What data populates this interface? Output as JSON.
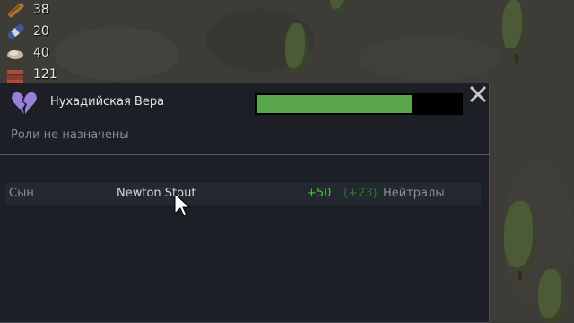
{
  "resources": [
    {
      "icon": "wood-icon",
      "count": "38"
    },
    {
      "icon": "medicine-icon",
      "count": "20"
    },
    {
      "icon": "meat-icon",
      "count": "40"
    },
    {
      "icon": "bricks-icon",
      "count": "121"
    }
  ],
  "ideology": {
    "name": "Нухадийская Вера",
    "icon": "broken-heart-icon",
    "icon_color": "#9a7fd6",
    "progress": 0.76,
    "roles_text": "Роли не назначены"
  },
  "relations": [
    {
      "relation": "Сын",
      "name": "Newton Stout",
      "opinion": "+50",
      "opinion_secondary": "(+23)",
      "faction": "Нейтралы"
    }
  ],
  "colors": {
    "panel_bg": "#1c1f26",
    "progress_fill": "#5aa64a",
    "positive": "#4cc13a"
  }
}
